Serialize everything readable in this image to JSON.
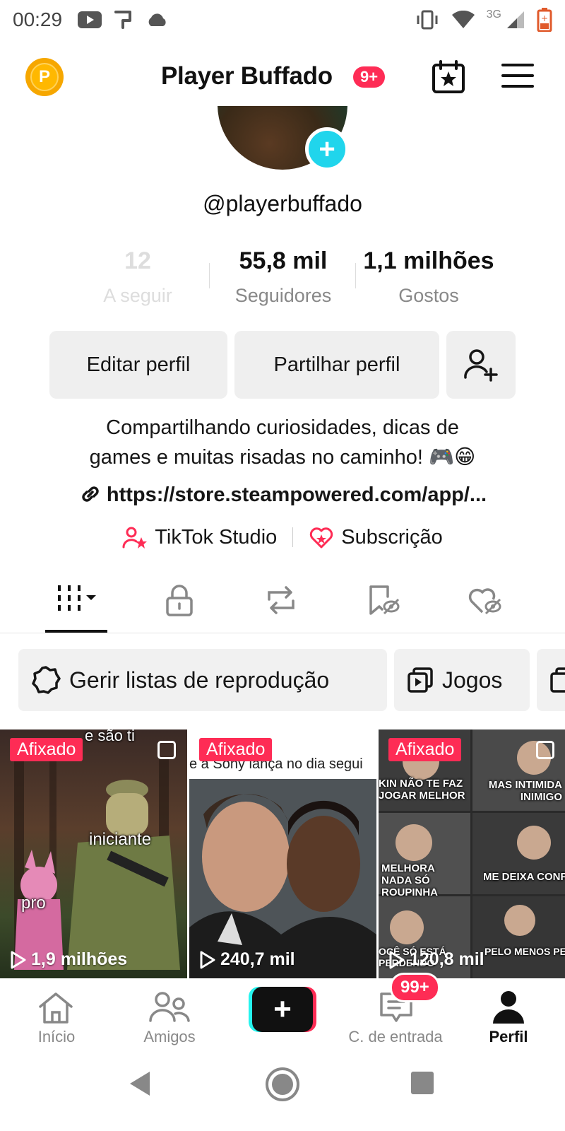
{
  "status_bar": {
    "time": "00:29",
    "network": "3G"
  },
  "header": {
    "title": "Player Buffado",
    "notification_badge": "9+",
    "coin_letter": "P"
  },
  "profile": {
    "username": "@playerbuffado",
    "stats": [
      {
        "value": "12",
        "label": "A seguir"
      },
      {
        "value": "55,8 mil",
        "label": "Seguidores"
      },
      {
        "value": "1,1 milhões",
        "label": "Gostos"
      }
    ],
    "edit_button": "Editar perfil",
    "share_button": "Partilhar perfil",
    "bio_line1": "Compartilhando curiosidades, dicas de",
    "bio_line2": "games e muitas risadas no caminho! 🎮😁",
    "link": "https://store.steampowered.com/app/...",
    "studio_label": "TikTok Studio",
    "subscription_label": "Subscrição"
  },
  "playlists": {
    "manage_label": "Gerir listas de reprodução",
    "games_label": "Jogos"
  },
  "videos": [
    {
      "pinned_label": "Afixado",
      "views": "1,9 milhões",
      "top_text": "e são ti",
      "caption_a": "iniciante",
      "caption_b": "pro"
    },
    {
      "pinned_label": "Afixado",
      "views": "240,7 mil",
      "top_text": "e a Sony lança no dia segui"
    },
    {
      "pinned_label": "Afixado",
      "views": "120,8 mil",
      "cap1": "KIN NÃO TE FAZ JOGAR MELHOR",
      "cap2": "MAS INTIMIDA INIMIGO",
      "cap3": "MELHORA NADA SÓ ROUPINHA",
      "cap4": "ME DEIXA CONFI",
      "cap5": "OCÊ SÓ ESTÁ PERDENDO",
      "cap6": "PELO MENOS PE COM ESTILO"
    }
  ],
  "bottom_nav": {
    "home": "Início",
    "friends": "Amigos",
    "inbox": "C. de entrada",
    "inbox_badge": "99+",
    "profile": "Perfil"
  },
  "colors": {
    "accent": "#fe2c55",
    "cyan": "#25f4ee",
    "plus_badge": "#20d5ec",
    "coin": "#f6a700"
  }
}
